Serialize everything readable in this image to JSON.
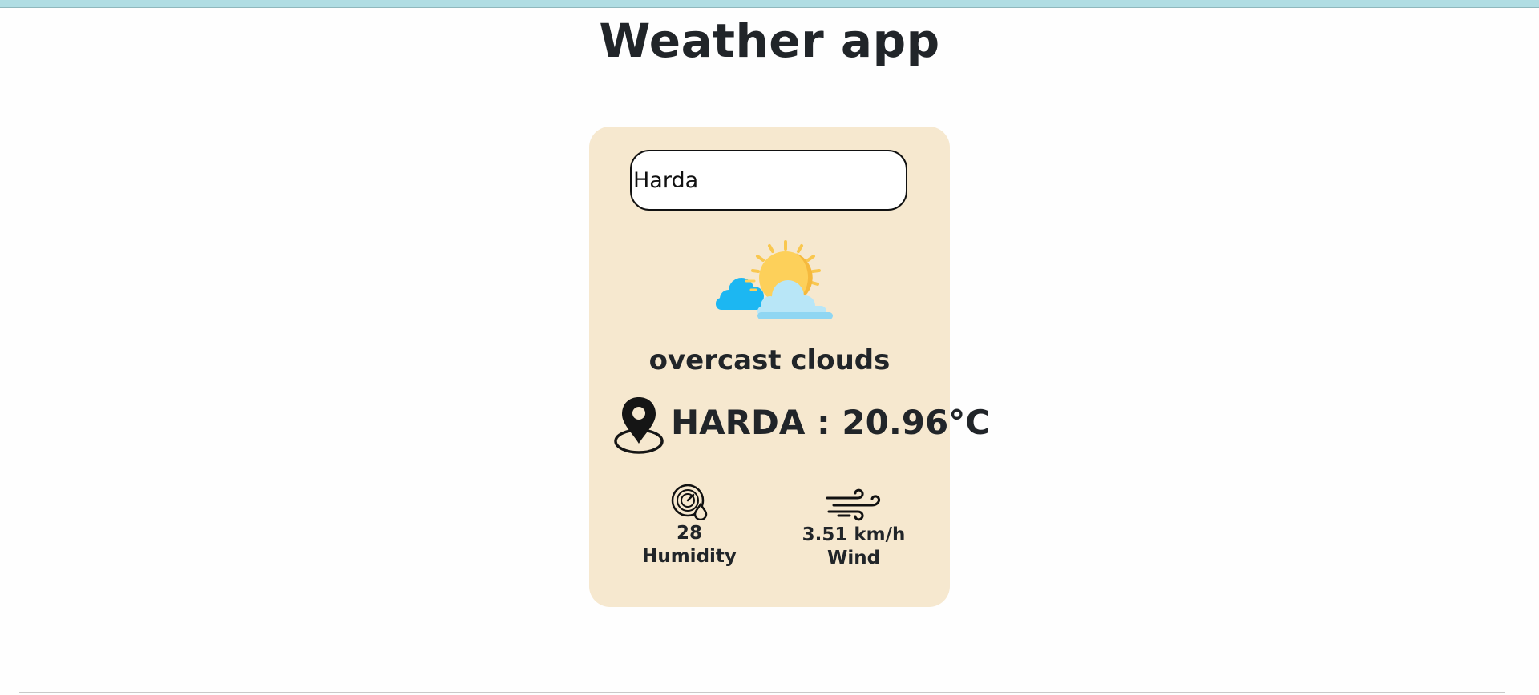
{
  "app": {
    "title": "Weather app"
  },
  "search": {
    "value": "Harda",
    "placeholder": ""
  },
  "weather": {
    "icon": "sun-behind-clouds-icon",
    "description": "overcast clouds",
    "location_icon": "location-pin-icon",
    "city_temp": "HARDA : 20.96°C"
  },
  "humidity": {
    "icon": "humidity-gauge-icon",
    "value": "28",
    "label": "Humidity"
  },
  "wind": {
    "icon": "wind-icon",
    "value": "3.51 km/h",
    "label": "Wind"
  },
  "colors": {
    "card_background": "#f6e8cf",
    "top_strip": "#b0dde3",
    "text": "#212529"
  }
}
